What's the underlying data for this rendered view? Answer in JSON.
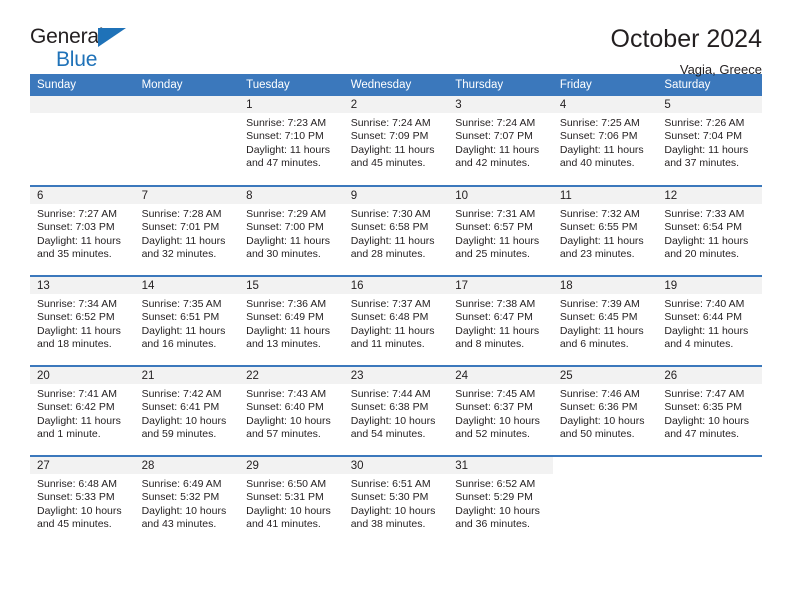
{
  "logo": {
    "word_one": "General",
    "word_two": "Blue",
    "triangle_icon": "triangle-icon",
    "accent_color": "#1f72b8"
  },
  "header": {
    "title": "October 2024",
    "location": "Vagia, Greece"
  },
  "calendar": {
    "header_color": "#3b78bc",
    "weekday_headers": [
      "Sunday",
      "Monday",
      "Tuesday",
      "Wednesday",
      "Thursday",
      "Friday",
      "Saturday"
    ],
    "labels": {
      "sunrise": "Sunrise:",
      "sunset": "Sunset:",
      "daylight": "Daylight:"
    },
    "weeks": [
      [
        {
          "day": "",
          "empty": true
        },
        {
          "day": "",
          "empty": true
        },
        {
          "day": "1",
          "sunrise": "Sunrise: 7:23 AM",
          "sunset": "Sunset: 7:10 PM",
          "daylight": "Daylight: 11 hours and 47 minutes."
        },
        {
          "day": "2",
          "sunrise": "Sunrise: 7:24 AM",
          "sunset": "Sunset: 7:09 PM",
          "daylight": "Daylight: 11 hours and 45 minutes."
        },
        {
          "day": "3",
          "sunrise": "Sunrise: 7:24 AM",
          "sunset": "Sunset: 7:07 PM",
          "daylight": "Daylight: 11 hours and 42 minutes."
        },
        {
          "day": "4",
          "sunrise": "Sunrise: 7:25 AM",
          "sunset": "Sunset: 7:06 PM",
          "daylight": "Daylight: 11 hours and 40 minutes."
        },
        {
          "day": "5",
          "sunrise": "Sunrise: 7:26 AM",
          "sunset": "Sunset: 7:04 PM",
          "daylight": "Daylight: 11 hours and 37 minutes."
        }
      ],
      [
        {
          "day": "6",
          "sunrise": "Sunrise: 7:27 AM",
          "sunset": "Sunset: 7:03 PM",
          "daylight": "Daylight: 11 hours and 35 minutes."
        },
        {
          "day": "7",
          "sunrise": "Sunrise: 7:28 AM",
          "sunset": "Sunset: 7:01 PM",
          "daylight": "Daylight: 11 hours and 32 minutes."
        },
        {
          "day": "8",
          "sunrise": "Sunrise: 7:29 AM",
          "sunset": "Sunset: 7:00 PM",
          "daylight": "Daylight: 11 hours and 30 minutes."
        },
        {
          "day": "9",
          "sunrise": "Sunrise: 7:30 AM",
          "sunset": "Sunset: 6:58 PM",
          "daylight": "Daylight: 11 hours and 28 minutes."
        },
        {
          "day": "10",
          "sunrise": "Sunrise: 7:31 AM",
          "sunset": "Sunset: 6:57 PM",
          "daylight": "Daylight: 11 hours and 25 minutes."
        },
        {
          "day": "11",
          "sunrise": "Sunrise: 7:32 AM",
          "sunset": "Sunset: 6:55 PM",
          "daylight": "Daylight: 11 hours and 23 minutes."
        },
        {
          "day": "12",
          "sunrise": "Sunrise: 7:33 AM",
          "sunset": "Sunset: 6:54 PM",
          "daylight": "Daylight: 11 hours and 20 minutes."
        }
      ],
      [
        {
          "day": "13",
          "sunrise": "Sunrise: 7:34 AM",
          "sunset": "Sunset: 6:52 PM",
          "daylight": "Daylight: 11 hours and 18 minutes."
        },
        {
          "day": "14",
          "sunrise": "Sunrise: 7:35 AM",
          "sunset": "Sunset: 6:51 PM",
          "daylight": "Daylight: 11 hours and 16 minutes."
        },
        {
          "day": "15",
          "sunrise": "Sunrise: 7:36 AM",
          "sunset": "Sunset: 6:49 PM",
          "daylight": "Daylight: 11 hours and 13 minutes."
        },
        {
          "day": "16",
          "sunrise": "Sunrise: 7:37 AM",
          "sunset": "Sunset: 6:48 PM",
          "daylight": "Daylight: 11 hours and 11 minutes."
        },
        {
          "day": "17",
          "sunrise": "Sunrise: 7:38 AM",
          "sunset": "Sunset: 6:47 PM",
          "daylight": "Daylight: 11 hours and 8 minutes."
        },
        {
          "day": "18",
          "sunrise": "Sunrise: 7:39 AM",
          "sunset": "Sunset: 6:45 PM",
          "daylight": "Daylight: 11 hours and 6 minutes."
        },
        {
          "day": "19",
          "sunrise": "Sunrise: 7:40 AM",
          "sunset": "Sunset: 6:44 PM",
          "daylight": "Daylight: 11 hours and 4 minutes."
        }
      ],
      [
        {
          "day": "20",
          "sunrise": "Sunrise: 7:41 AM",
          "sunset": "Sunset: 6:42 PM",
          "daylight": "Daylight: 11 hours and 1 minute."
        },
        {
          "day": "21",
          "sunrise": "Sunrise: 7:42 AM",
          "sunset": "Sunset: 6:41 PM",
          "daylight": "Daylight: 10 hours and 59 minutes."
        },
        {
          "day": "22",
          "sunrise": "Sunrise: 7:43 AM",
          "sunset": "Sunset: 6:40 PM",
          "daylight": "Daylight: 10 hours and 57 minutes."
        },
        {
          "day": "23",
          "sunrise": "Sunrise: 7:44 AM",
          "sunset": "Sunset: 6:38 PM",
          "daylight": "Daylight: 10 hours and 54 minutes."
        },
        {
          "day": "24",
          "sunrise": "Sunrise: 7:45 AM",
          "sunset": "Sunset: 6:37 PM",
          "daylight": "Daylight: 10 hours and 52 minutes."
        },
        {
          "day": "25",
          "sunrise": "Sunrise: 7:46 AM",
          "sunset": "Sunset: 6:36 PM",
          "daylight": "Daylight: 10 hours and 50 minutes."
        },
        {
          "day": "26",
          "sunrise": "Sunrise: 7:47 AM",
          "sunset": "Sunset: 6:35 PM",
          "daylight": "Daylight: 10 hours and 47 minutes."
        }
      ],
      [
        {
          "day": "27",
          "sunrise": "Sunrise: 6:48 AM",
          "sunset": "Sunset: 5:33 PM",
          "daylight": "Daylight: 10 hours and 45 minutes."
        },
        {
          "day": "28",
          "sunrise": "Sunrise: 6:49 AM",
          "sunset": "Sunset: 5:32 PM",
          "daylight": "Daylight: 10 hours and 43 minutes."
        },
        {
          "day": "29",
          "sunrise": "Sunrise: 6:50 AM",
          "sunset": "Sunset: 5:31 PM",
          "daylight": "Daylight: 10 hours and 41 minutes."
        },
        {
          "day": "30",
          "sunrise": "Sunrise: 6:51 AM",
          "sunset": "Sunset: 5:30 PM",
          "daylight": "Daylight: 10 hours and 38 minutes."
        },
        {
          "day": "31",
          "sunrise": "Sunrise: 6:52 AM",
          "sunset": "Sunset: 5:29 PM",
          "daylight": "Daylight: 10 hours and 36 minutes."
        },
        {
          "day": "",
          "blank": true
        },
        {
          "day": "",
          "blank": true
        }
      ]
    ]
  }
}
